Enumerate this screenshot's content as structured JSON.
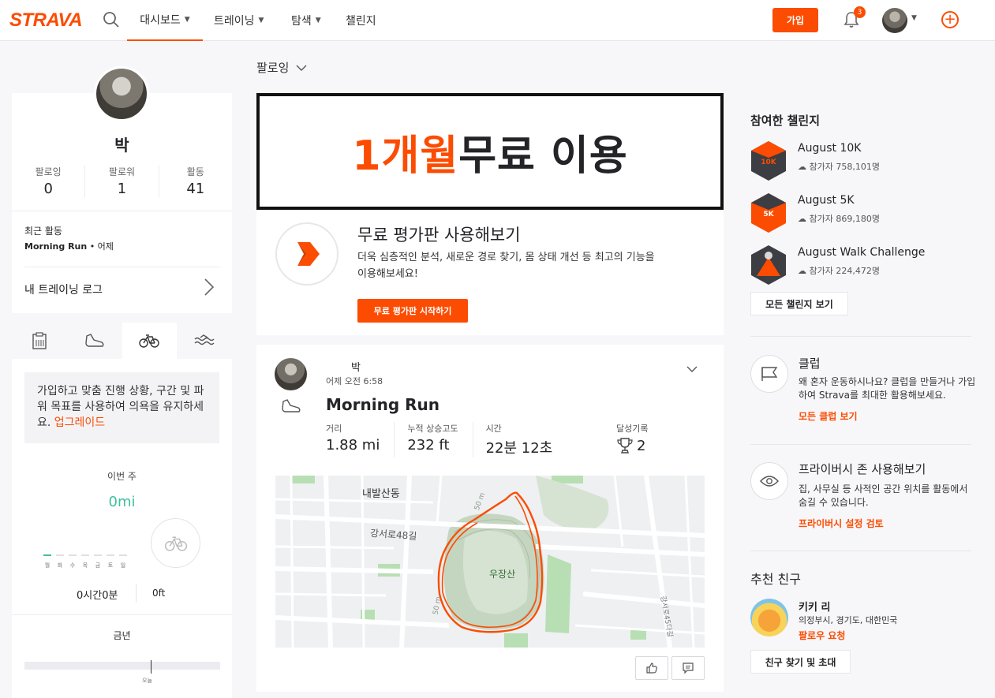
{
  "nav": {
    "logo": "STRAVA",
    "items": [
      {
        "label": "대시보드",
        "dropdown": true
      },
      {
        "label": "트레이닝",
        "dropdown": true
      },
      {
        "label": "탐색",
        "dropdown": true
      },
      {
        "label": "챌린지",
        "dropdown": false
      }
    ],
    "join_label": "가입",
    "notification_count": "3"
  },
  "profile": {
    "name": "박",
    "stats": [
      {
        "label": "팔로잉",
        "value": "0"
      },
      {
        "label": "팔로워",
        "value": "1"
      },
      {
        "label": "활동",
        "value": "41"
      }
    ],
    "recent_label": "최근 활동",
    "recent_activity": "Morning Run",
    "recent_when": " • 어제",
    "training_log": "내 트레이닝 로그"
  },
  "training": {
    "upsell_text": "가입하고 맞춤 진행 상황, 구간 및 파워 목표를 사용하여 의욕을 유지하세요. ",
    "upsell_link": "업그레이드",
    "week_label": "이번 주",
    "week_distance": "0mi",
    "week_days": [
      "월",
      "화",
      "수",
      "목",
      "금",
      "토",
      "일"
    ],
    "week_time": "0시간0분",
    "week_elevation": "0ft",
    "year_label": "금년",
    "today_label": "오늘"
  },
  "feed": {
    "filter_label": "팔로잉",
    "ad_highlight": "1개월",
    "ad_text": " 무료 이용",
    "trial": {
      "title": "무료 평가판 사용해보기",
      "desc": "더욱 심층적인 분석, 새로운 경로 찾기, 몸 상태 개선 등 최고의 기능을 이용해보세요!",
      "button": "무료 평가판 시작하기"
    },
    "activity": {
      "athlete": "박",
      "timestamp": "어제 오전 6:58",
      "title": "Morning Run",
      "stats": [
        {
          "label": "거리",
          "value": "1.88 mi"
        },
        {
          "label": "누적 상승고도",
          "value": "232 ft"
        },
        {
          "label": "시간",
          "value": "22분 12초"
        }
      ],
      "achievements_label": "달성기록",
      "achievements_value": "2",
      "map_labels": {
        "district": "내발산동",
        "road": "강서로48길",
        "mountain": "우장산",
        "contour1": "50 m",
        "contour2": "50 m",
        "street2": "강서로45다길"
      }
    }
  },
  "sidebar_right": {
    "challenges_title": "참여한 챌린지",
    "challenges": [
      {
        "name": "August 10K",
        "participants": "참가자 758,101명",
        "badge": "10K",
        "color": "#fc4c02"
      },
      {
        "name": "August 5K",
        "participants": "참가자 869,180명",
        "badge": "5K",
        "color": "#fc4c02"
      },
      {
        "name": "August Walk Challenge",
        "participants": "참가자 224,472명",
        "badge": "",
        "color": "#fc4c02"
      }
    ],
    "all_challenges": "모든 챌린지 보기",
    "clubs": {
      "title": "클럽",
      "desc": "왜 혼자 운동하시나요? 클럽을 만들거나 가입하여 Strava를 최대한 활용해보세요.",
      "link": "모든 클럽 보기"
    },
    "privacy": {
      "title": "프라이버시 존 사용해보기",
      "desc": "집, 사무실 등 사적인 공간 위치를 활동에서 숨길 수 있습니다.",
      "link": "프라이버시 설정 검토"
    },
    "friends_title": "추천 친구",
    "friend": {
      "name": "키키 리",
      "location": "의정부시, 경기도, 대한민국",
      "follow": "팔로우 요청"
    },
    "invite": "친구 찾기 및 초대"
  },
  "colors": {
    "accent": "#fc4c02",
    "green": "#3fbf9f"
  }
}
